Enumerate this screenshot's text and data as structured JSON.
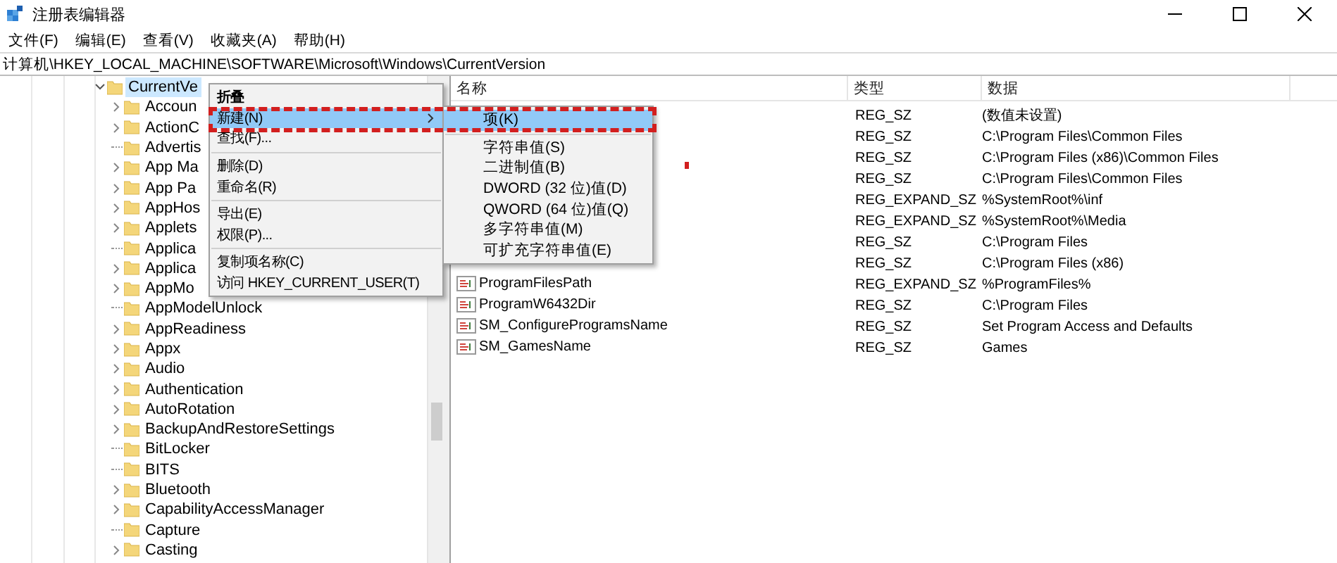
{
  "window": {
    "title": "注册表编辑器"
  },
  "menu_bar": [
    "文件(F)",
    "编辑(E)",
    "查看(V)",
    "收藏夹(A)",
    "帮助(H)"
  ],
  "address": "计算机\\HKEY_LOCAL_MACHINE\\SOFTWARE\\Microsoft\\Windows\\CurrentVersion",
  "tree": [
    {
      "label": "CurrentVe",
      "kind": "branch",
      "expanded": true,
      "selected": true,
      "children": [
        {
          "label": "Accoun",
          "kind": "branch",
          "selected": false
        },
        {
          "label": "ActionC",
          "kind": "branch",
          "selected": false
        },
        {
          "label": "Advertis",
          "kind": "leaf",
          "selected": false
        },
        {
          "label": "App Ma",
          "kind": "branch",
          "selected": false
        },
        {
          "label": "App Pa",
          "kind": "branch",
          "selected": false
        },
        {
          "label": "AppHos",
          "kind": "branch",
          "selected": false
        },
        {
          "label": "Applets",
          "kind": "branch",
          "selected": false
        },
        {
          "label": "Applica",
          "kind": "leaf",
          "selected": false
        },
        {
          "label": "Applica",
          "kind": "branch",
          "selected": false
        },
        {
          "label": "AppMo",
          "kind": "branch",
          "selected": false
        },
        {
          "label": "AppModelUnlock",
          "kind": "leaf",
          "selected": false
        },
        {
          "label": "AppReadiness",
          "kind": "branch",
          "selected": false
        },
        {
          "label": "Appx",
          "kind": "branch",
          "selected": false
        },
        {
          "label": "Audio",
          "kind": "branch",
          "selected": false
        },
        {
          "label": "Authentication",
          "kind": "branch",
          "selected": false
        },
        {
          "label": "AutoRotation",
          "kind": "branch",
          "selected": false
        },
        {
          "label": "BackupAndRestoreSettings",
          "kind": "branch",
          "selected": false
        },
        {
          "label": "BitLocker",
          "kind": "leaf",
          "selected": false
        },
        {
          "label": "BITS",
          "kind": "leaf",
          "selected": false
        },
        {
          "label": "Bluetooth",
          "kind": "branch",
          "selected": false
        },
        {
          "label": "CapabilityAccessManager",
          "kind": "branch",
          "selected": false
        },
        {
          "label": "Capture",
          "kind": "leaf",
          "selected": false
        },
        {
          "label": "Casting",
          "kind": "branch",
          "selected": false
        }
      ]
    }
  ],
  "table": {
    "columns": [
      "名称",
      "类型",
      "数据"
    ],
    "rows": [
      {
        "type": "REG_SZ",
        "data": "(数值未设置)"
      },
      {
        "type": "REG_SZ",
        "data": "C:\\Program Files\\Common Files"
      },
      {
        "type": "REG_SZ",
        "data": "C:\\Program Files (x86)\\Common Files"
      },
      {
        "type": "REG_SZ",
        "data": "C:\\Program Files\\Common Files"
      },
      {
        "type": "REG_EXPAND_SZ",
        "data": "%SystemRoot%\\inf"
      },
      {
        "type": "REG_EXPAND_SZ",
        "data": "%SystemRoot%\\Media"
      },
      {
        "type": "REG_SZ",
        "data": "C:\\Program Files"
      },
      {
        "type": "REG_SZ",
        "data": "C:\\Program Files (x86)"
      },
      {
        "name": "ProgramFilesPath",
        "type": "REG_EXPAND_SZ",
        "data": "%ProgramFiles%"
      },
      {
        "name": "ProgramW6432Dir",
        "type": "REG_SZ",
        "data": "C:\\Program Files"
      },
      {
        "name": "SM_ConfigureProgramsName",
        "type": "REG_SZ",
        "data": "Set Program Access and Defaults"
      },
      {
        "name": "SM_GamesName",
        "type": "REG_SZ",
        "data": "Games"
      }
    ]
  },
  "context_menu": [
    {
      "kind": "item",
      "label": "折叠",
      "bold": true,
      "selected": false,
      "submenu": false
    },
    {
      "kind": "item",
      "label": "新建(N)",
      "bold": false,
      "selected": true,
      "submenu": true
    },
    {
      "kind": "item",
      "label": "查找(F)...",
      "bold": false,
      "selected": false,
      "submenu": false
    },
    {
      "kind": "separator"
    },
    {
      "kind": "item",
      "label": "删除(D)",
      "bold": false,
      "selected": false,
      "submenu": false
    },
    {
      "kind": "item",
      "label": "重命名(R)",
      "bold": false,
      "selected": false,
      "submenu": false
    },
    {
      "kind": "separator"
    },
    {
      "kind": "item",
      "label": "导出(E)",
      "bold": false,
      "selected": false,
      "submenu": false
    },
    {
      "kind": "item",
      "label": "权限(P)...",
      "bold": false,
      "selected": false,
      "submenu": false
    },
    {
      "kind": "separator"
    },
    {
      "kind": "item",
      "label": "复制项名称(C)",
      "bold": false,
      "selected": false,
      "submenu": false
    },
    {
      "kind": "item",
      "label": "访问 HKEY_CURRENT_USER(T)",
      "bold": false,
      "selected": false,
      "submenu": false
    }
  ],
  "submenu": [
    {
      "kind": "item",
      "label": "项(K)",
      "selected": true
    },
    {
      "kind": "separator"
    },
    {
      "kind": "item",
      "label": "字符串值(S)",
      "selected": false
    },
    {
      "kind": "item",
      "label": "二进制值(B)",
      "selected": false
    },
    {
      "kind": "item",
      "label": "DWORD (32 位)值(D)",
      "selected": false
    },
    {
      "kind": "item",
      "label": "QWORD (64 位)值(Q)",
      "selected": false
    },
    {
      "kind": "item",
      "label": "多字符串值(M)",
      "selected": false
    },
    {
      "kind": "item",
      "label": "可扩充字符串值(E)",
      "selected": false
    }
  ]
}
